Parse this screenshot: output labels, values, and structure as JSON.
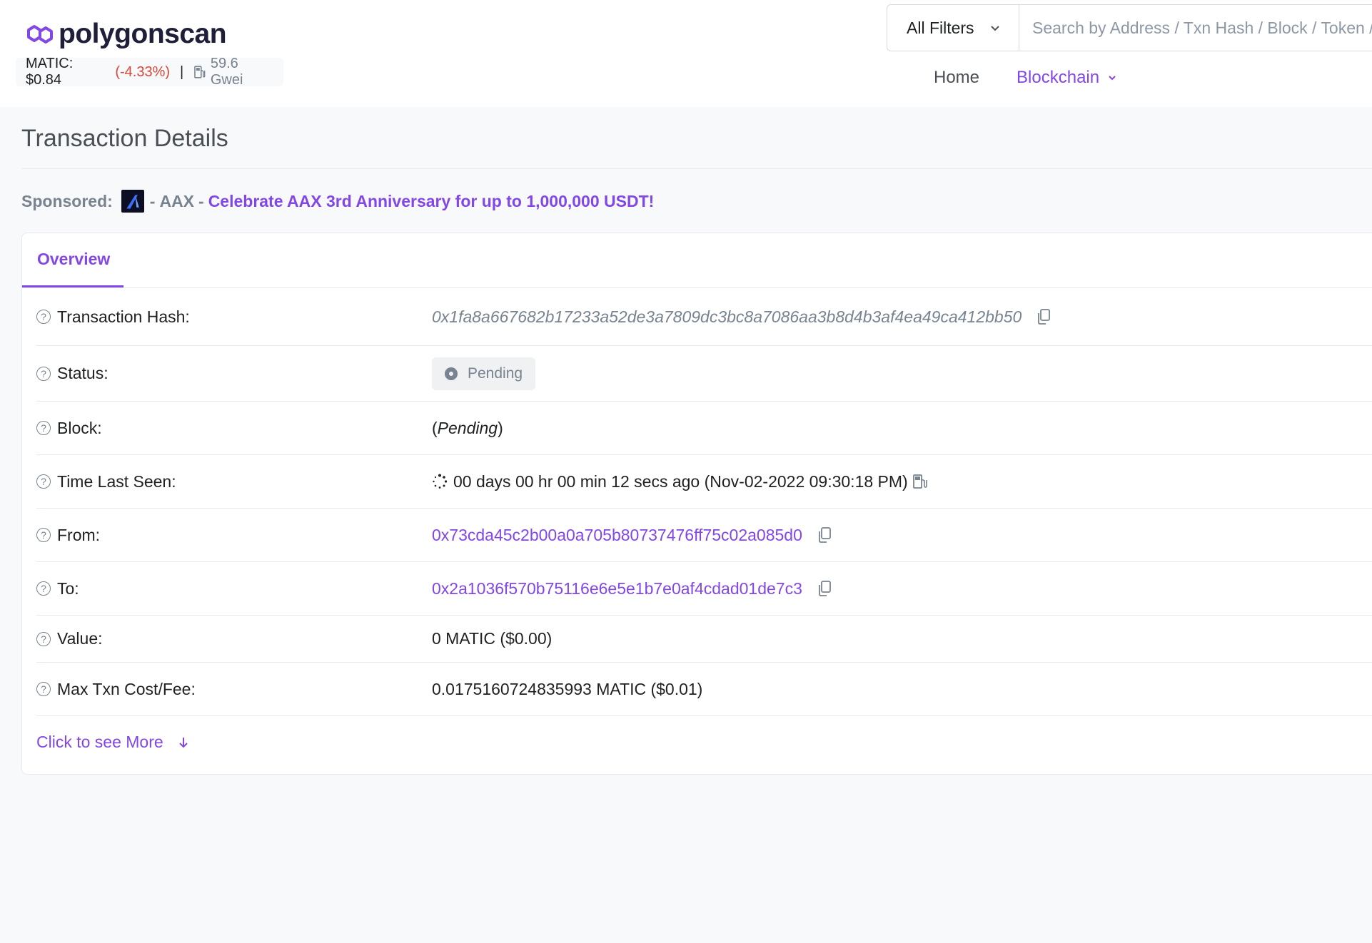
{
  "header": {
    "logo_text": "polygonscan",
    "price_label": "MATIC: $0.84",
    "price_change": "(-4.33%)",
    "separator": "|",
    "gas": "59.6 Gwei",
    "filter": "All Filters",
    "search_placeholder": "Search by Address / Txn Hash / Block / Token / Ens",
    "nav": {
      "home": "Home",
      "blockchain": "Blockchain"
    }
  },
  "page": {
    "title": "Transaction Details"
  },
  "sponsored": {
    "label": "Sponsored:",
    "dash1": "-",
    "name": "AAX",
    "dash2": "-",
    "link": "Celebrate AAX 3rd Anniversary for up to 1,000,000 USDT!"
  },
  "overview": {
    "tab": "Overview",
    "rows": {
      "hash_label": "Transaction Hash:",
      "hash_value": "0x1fa8a667682b17233a52de3a7809dc3bc8a7086aa3b8d4b3af4ea49ca412bb50",
      "status_label": "Status:",
      "status_value": "Pending",
      "block_label": "Block:",
      "block_value_open": "(",
      "block_value": "Pending",
      "block_value_close": ")",
      "time_label": "Time Last Seen:",
      "time_value": "00 days 00 hr 00 min 12 secs ago (Nov-02-2022 09:30:18 PM)",
      "from_label": "From:",
      "from_value": "0x73cda45c2b00a0a705b80737476ff75c02a085d0",
      "to_label": "To:",
      "to_value": "0x2a1036f570b75116e6e5e1b7e0af4cdad01de7c3",
      "value_label": "Value:",
      "value_value": "0 MATIC ($0.00)",
      "fee_label": "Max Txn Cost/Fee:",
      "fee_value": "0.0175160724835993 MATIC ($0.01)"
    },
    "more": "Click to see More"
  },
  "colors": {
    "accent": "#8247e5",
    "negative": "#de4437",
    "muted": "#77838f"
  },
  "icons": [
    "polygon-logo-icon",
    "gas-pump-icon",
    "chevron-down-icon",
    "question-icon",
    "copy-icon",
    "spinner-icon",
    "arrow-down-icon",
    "aax-logo-icon"
  ]
}
